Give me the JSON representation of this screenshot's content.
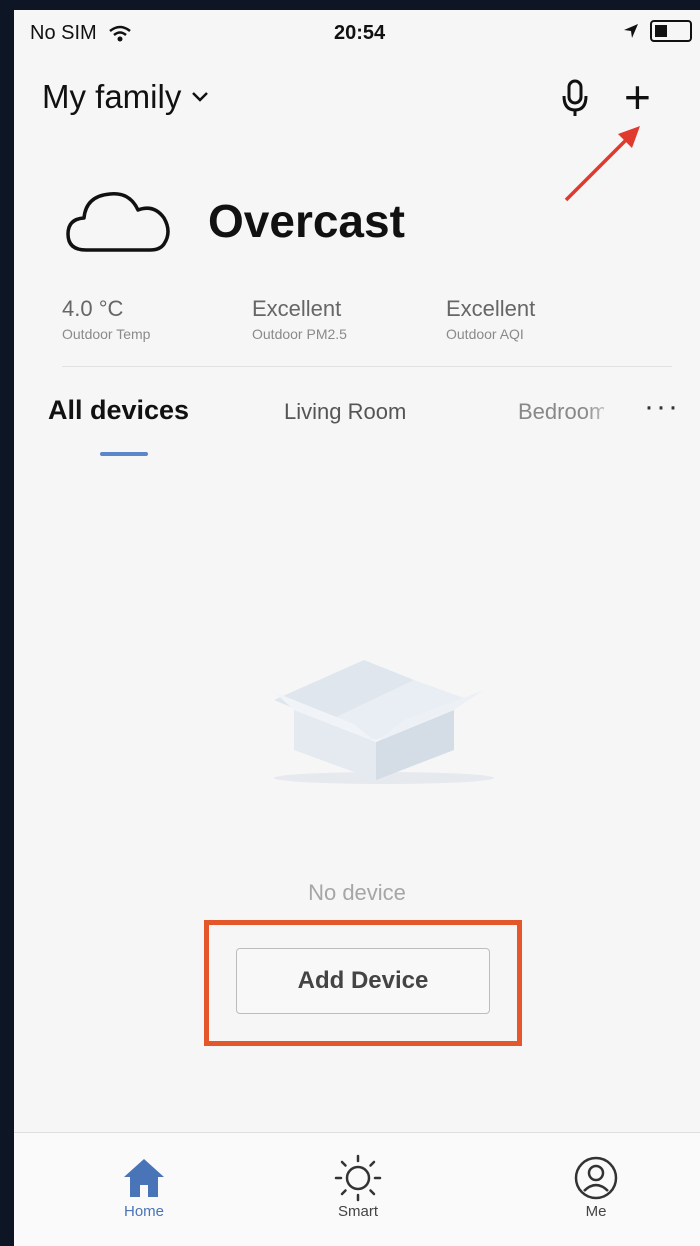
{
  "status_bar": {
    "carrier": "No SIM",
    "time": "20:54"
  },
  "header": {
    "family_name": "My family"
  },
  "weather": {
    "condition": "Overcast"
  },
  "metrics": [
    {
      "value": "4.0 °C",
      "label": "Outdoor Temp"
    },
    {
      "value": "Excellent",
      "label": "Outdoor PM2.5"
    },
    {
      "value": "Excellent",
      "label": "Outdoor AQI"
    }
  ],
  "tabs": [
    {
      "label": "All devices",
      "active": true
    },
    {
      "label": "Living Room",
      "active": false
    },
    {
      "label": "Bedroom",
      "active": false
    }
  ],
  "more_label": "···",
  "empty_state": {
    "message": "No device",
    "button_label": "Add Device"
  },
  "tab_bar": [
    {
      "label": "Home",
      "icon": "home-icon",
      "active": true
    },
    {
      "label": "Smart",
      "icon": "sun-icon",
      "active": false
    },
    {
      "label": "Me",
      "icon": "user-icon",
      "active": false
    }
  ],
  "colors": {
    "accent": "#4a74b8",
    "highlight": "#e3572a",
    "arrow": "#e03a2f"
  }
}
